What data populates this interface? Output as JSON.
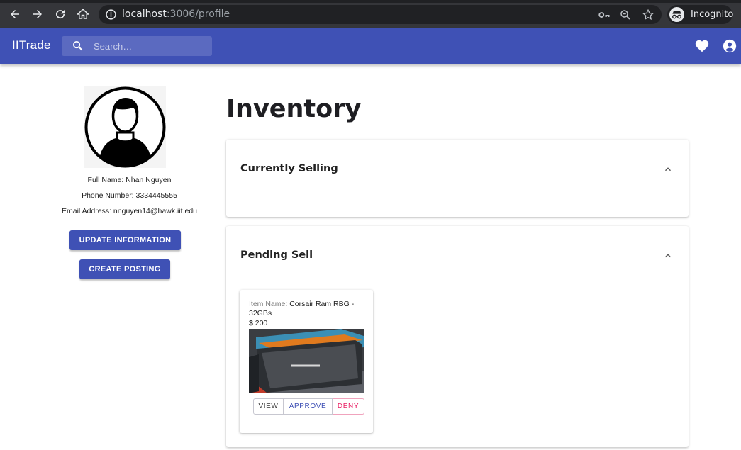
{
  "browser": {
    "url_host": "localhost",
    "url_path": ":3006/profile",
    "profile_label": "Incognito"
  },
  "appbar": {
    "brand": "IITrade",
    "search_placeholder": "Search…"
  },
  "profile": {
    "full_name": "Full Name: Nhan Nguyen",
    "phone": "Phone Number: 3334445555",
    "email": "Email Address: nnguyen14@hawk.iit.edu",
    "update_button": "UPDATE INFORMATION",
    "create_button": "CREATE POSTING"
  },
  "main": {
    "title": "Inventory",
    "sections": [
      {
        "label": "Currently Selling"
      },
      {
        "label": "Pending Sell"
      }
    ]
  },
  "pending_item": {
    "name_label": "Item Name: ",
    "name": "Corsair Ram RBG -",
    "name_line2": "32GBs",
    "price": "$ 200",
    "buttons": [
      "VIEW",
      "APPROVE",
      "DENY"
    ]
  },
  "colors": {
    "primary": "#3f51b5",
    "deny": "#e91e63"
  }
}
